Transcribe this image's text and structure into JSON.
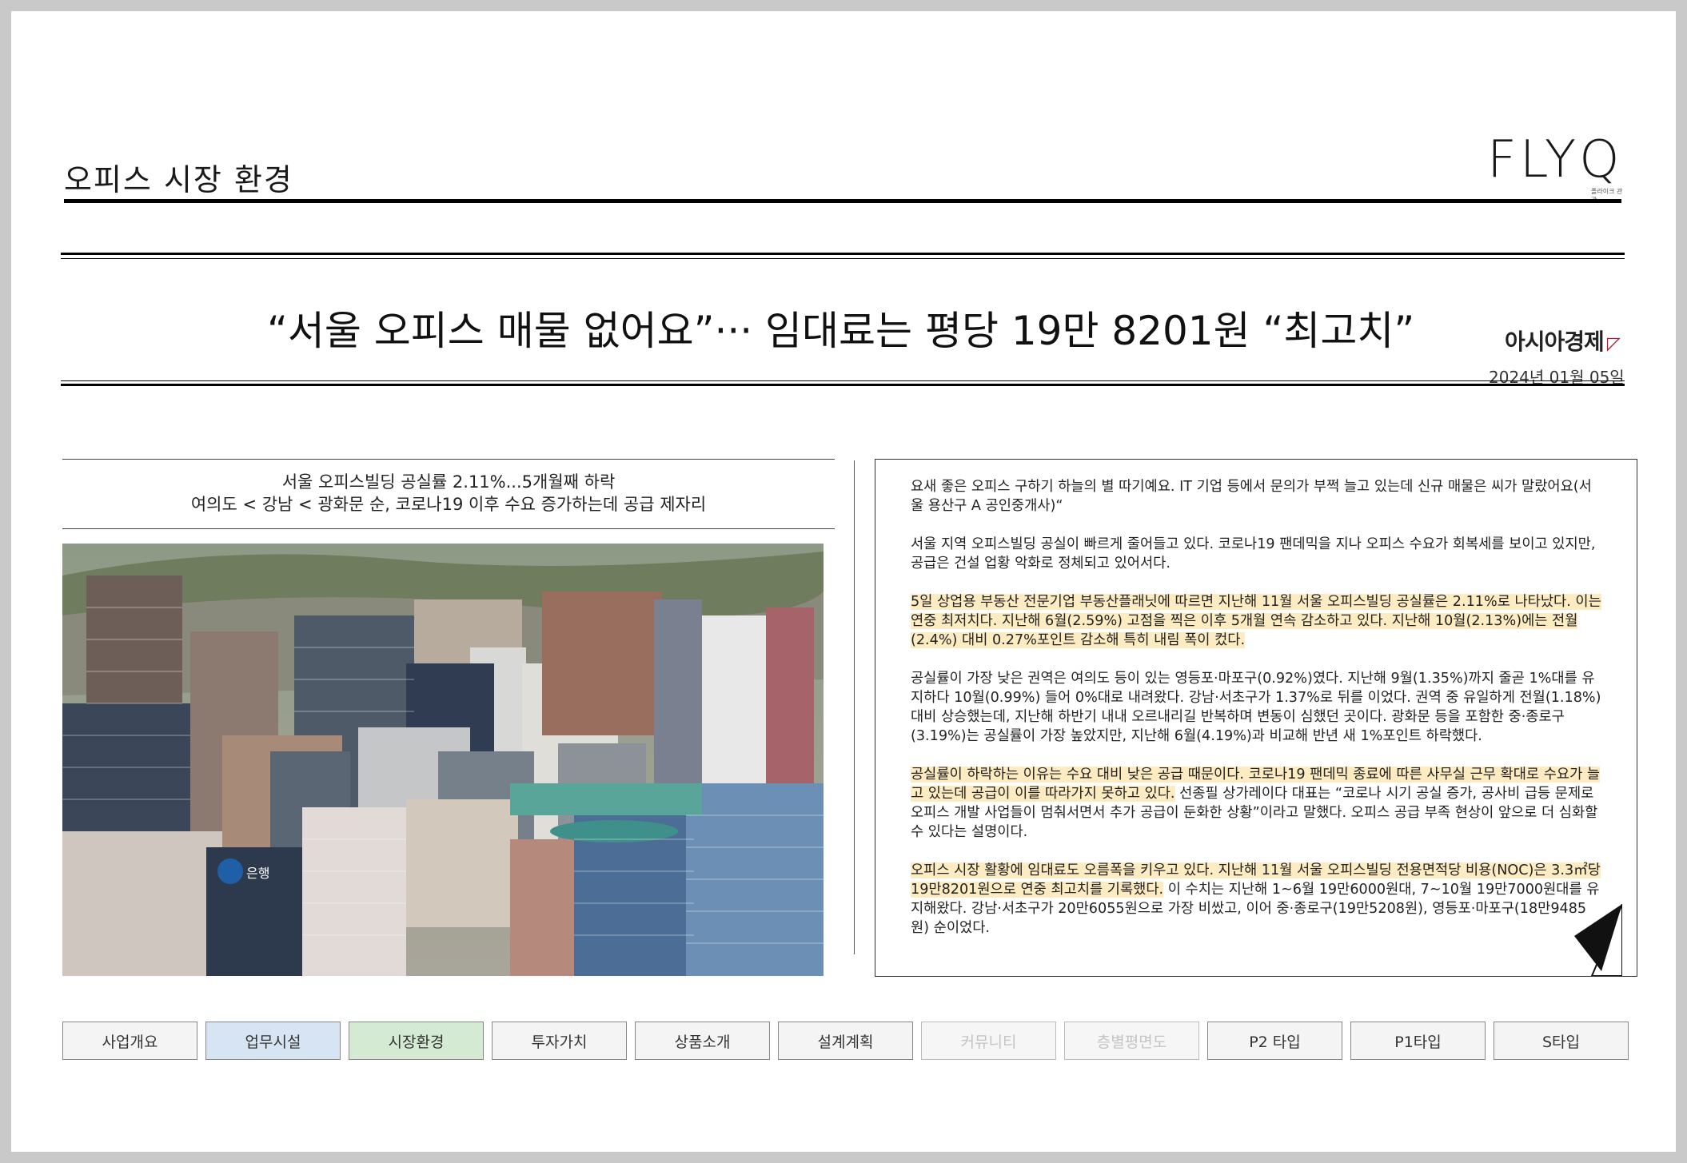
{
  "header": {
    "section_title": "오피스 시장 환경",
    "logo_text": "FLYQ",
    "logo_sub": "플라이크 관광"
  },
  "article": {
    "headline": "“서울 오피스 매물 없어요”··· 임대료는 평당 19만 8201원 “최고치”",
    "publisher": "아시아경제",
    "date": "2024년 01월 05일",
    "subhead_1": "서울 오피스빌딩 공실률 2.11%...5개월째 하락",
    "subhead_2": "여의도 < 강남 < 광화문 순, 코로나19 이후 수요 증가하는데 공급 제자리",
    "photo_bank_text": "은행",
    "paragraphs": [
      {
        "plain": "요새 좋은 오피스 구하기 하늘의 별 따기예요. IT 기업 등에서 문의가 부쩍 늘고 있는데 신규 매물은 씨가 말랐어요(서울 용산구 A 공인중개사)“"
      },
      {
        "plain": "서울 지역 오피스빌딩 공실이 빠르게 줄어들고 있다. 코로나19 팬데믹을 지나 오피스 수요가 회복세를 보이고 있지만, 공급은 건설 업황 악화로 정체되고 있어서다."
      },
      {
        "highlight": "5일 상업용 부동산 전문기업 부동산플래닛에 따르면 지난해 11월 서울 오피스빌딩 공실률은 2.11%로 나타났다. 이는 연중 최저치다. 지난해 6월(2.59%) 고점을 찍은 이후 5개월 연속 감소하고 있다. 지난해 10월(2.13%)에는 전월(2.4%) 대비 0.27%포인트 감소해 특히 내림 폭이 컸다."
      },
      {
        "plain": "공실률이 가장 낮은 권역은 여의도 등이 있는 영등포·마포구(0.92%)였다. 지난해 9월(1.35%)까지 줄곧 1%대를 유지하다 10월(0.99%) 들어 0%대로 내려왔다. 강남·서초구가 1.37%로 뒤를 이었다. 권역 중 유일하게 전월(1.18%) 대비 상승했는데, 지난해 하반기 내내 오르내리길 반복하며 변동이 심했던 곳이다. 광화문 등을 포함한 중·종로구(3.19%)는 공실률이 가장 높았지만, 지난해 6월(4.19%)과 비교해 반년 새 1%포인트 하락했다."
      },
      {
        "highlight": "공실률이 하락하는 이유는 수요 대비 낮은 공급 때문이다. 코로나19 팬데믹 종료에 따른 사무실 근무 확대로 수요가 늘고 있는데 공급이 이를 따라가지 못하고 있다.",
        "plain": " 선종필 상가레이다 대표는 “코로나 시기 공실 증가, 공사비 급등 문제로 오피스 개발 사업들이 멈춰서면서 추가 공급이 둔화한 상황”이라고 말했다. 오피스 공급 부족 현상이 앞으로 더 심화할 수 있다는 설명이다."
      },
      {
        "highlight": "오피스 시장 활황에 임대료도 오름폭을 키우고 있다. 지난해 11월 서울 오피스빌딩 전용면적당 비용(NOC)은 3.3㎡당 19만8201원으로 연중 최고치를 기록했다.",
        "plain": " 이 수치는 지난해 1~6월 19만6000원대, 7~10월 19만7000원대를 유지해왔다. 강남·서초구가 20만6055원으로 가장 비쌌고, 이어 중·종로구(19만5208원), 영등포·마포구(18만9485원) 순이었다."
      }
    ]
  },
  "nav": [
    {
      "label": "사업개요",
      "style": "default"
    },
    {
      "label": "업무시설",
      "style": "blue"
    },
    {
      "label": "시장환경",
      "style": "green"
    },
    {
      "label": "투자가치",
      "style": "default"
    },
    {
      "label": "상품소개",
      "style": "default"
    },
    {
      "label": "설계계획",
      "style": "default"
    },
    {
      "label": "커뮤니티",
      "style": "disabled"
    },
    {
      "label": "층별평면도",
      "style": "disabled"
    },
    {
      "label": "P2 타입",
      "style": "default"
    },
    {
      "label": "P1타입",
      "style": "default"
    },
    {
      "label": "S타입",
      "style": "default"
    }
  ],
  "colors": {
    "highlight": "#fdebc1",
    "nav_blue": "#d6e4f3",
    "nav_green": "#d4ead3",
    "publisher_mark": "#c8102e"
  }
}
